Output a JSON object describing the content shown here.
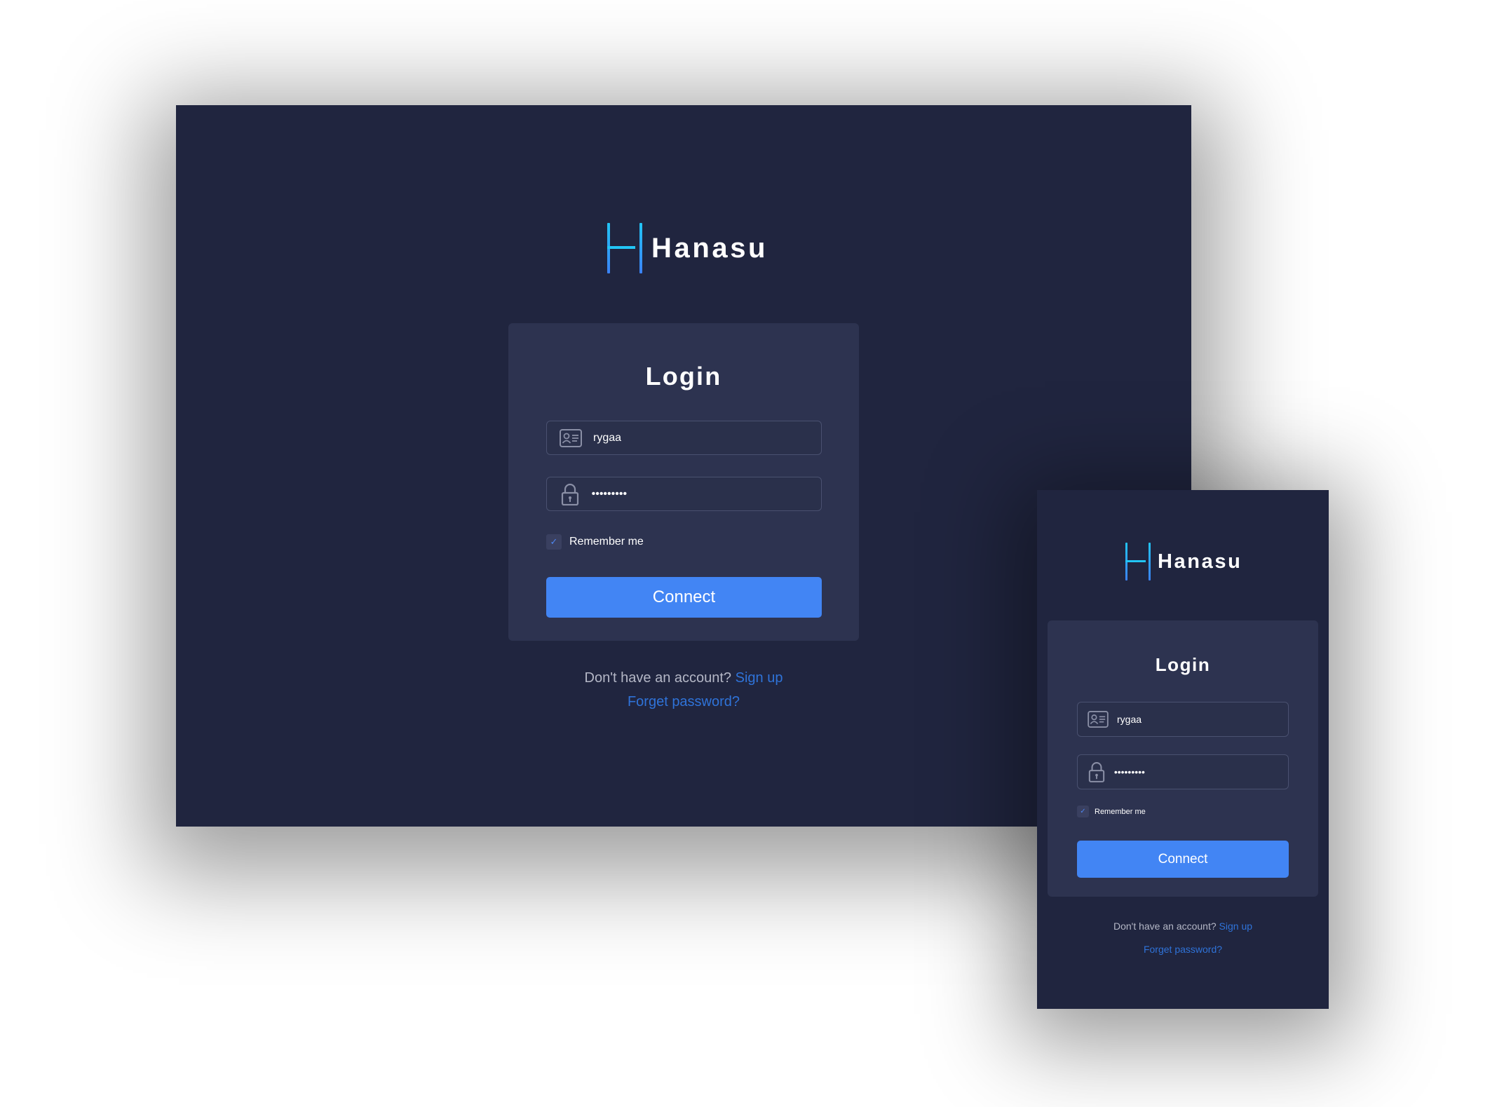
{
  "brand": {
    "name": "Hanasu",
    "logo_colors": {
      "top": "#22c5f5",
      "bottom": "#3b82f6"
    }
  },
  "login": {
    "title": "Login",
    "username": {
      "value": "rygaa",
      "icon": "id-card-icon"
    },
    "password": {
      "value": "•••••••••",
      "icon": "lock-icon"
    },
    "remember": {
      "label": "Remember me",
      "checked": true
    },
    "connect_label": "Connect",
    "no_account_text": "Don't have an account?",
    "signup_label": "Sign up",
    "forgot_label": "Forget password?"
  },
  "colors": {
    "background": "#20253f",
    "card": "#2d3350",
    "accent": "#4285f4",
    "link": "#2f73d9"
  }
}
